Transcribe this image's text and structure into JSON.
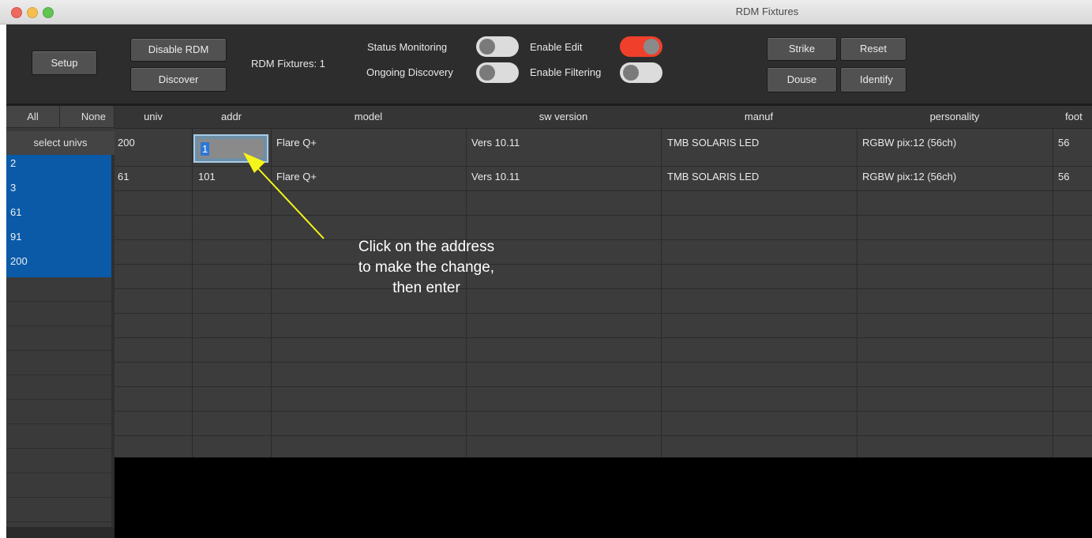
{
  "window": {
    "title": "RDM Fixtures"
  },
  "toolbar": {
    "setup": "Setup",
    "disable_rdm": "Disable RDM",
    "discover": "Discover",
    "fixtures_count": "RDM Fixtures: 1",
    "status_monitoring": "Status Monitoring",
    "ongoing_discovery": "Ongoing Discovery",
    "enable_edit": "Enable Edit",
    "enable_filtering": "Enable Filtering",
    "strike": "Strike",
    "reset": "Reset",
    "douse": "Douse",
    "identify": "Identify",
    "toggles": {
      "status_monitoring": false,
      "ongoing_discovery": false,
      "enable_edit": true,
      "enable_filtering": false
    },
    "colors": {
      "toggle_on": "#f0402b",
      "toggle_off": "#dcdcdc"
    }
  },
  "sidebar": {
    "all": "All",
    "none": "None",
    "header": "select univs",
    "universes": [
      "2",
      "3",
      "61",
      "91",
      "200"
    ],
    "selected_color": "#0a5aa8"
  },
  "table": {
    "columns": [
      "univ",
      "addr",
      "model",
      "sw version",
      "manuf",
      "personality",
      "foot"
    ],
    "rows": [
      {
        "univ": "200",
        "addr": "1",
        "model": "Flare Q+",
        "sw": "Vers 10.11",
        "manuf": "TMB SOLARIS LED",
        "personality": "RGBW pix:12 (56ch)",
        "foot": "56"
      },
      {
        "univ": "61",
        "addr": "101",
        "model": "Flare Q+",
        "sw": "Vers 10.11",
        "manuf": "TMB SOLARIS LED",
        "personality": "RGBW pix:12 (56ch)",
        "foot": "56"
      }
    ]
  },
  "annotation": {
    "line1": "Click on the address",
    "line2": "to make the change,",
    "line3": "then enter",
    "arrow_color": "#f5f51a"
  }
}
